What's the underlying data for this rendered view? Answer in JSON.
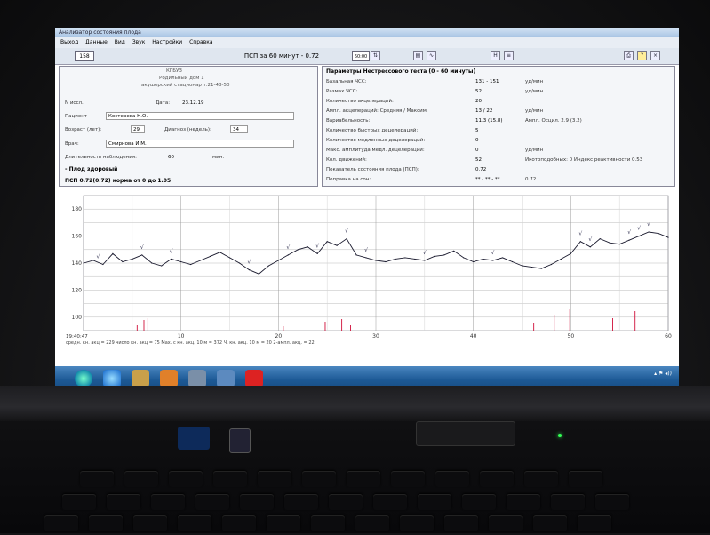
{
  "app": {
    "window_title": "Анализатор состояния плода",
    "menu": [
      "Выход",
      "Данные",
      "Вид",
      "Звук",
      "Настройки",
      "Справка"
    ]
  },
  "toolbar": {
    "id_value": "158",
    "title": "ПСП за 60 минут - 0.72",
    "zoom_value": "60:00",
    "buttons": [
      "chart-icon",
      "wave-icon",
      "H-icon",
      "list-icon",
      "print-icon",
      "help-icon",
      "close-icon"
    ]
  },
  "patient": {
    "org_name": "КГБУЗ",
    "org_line2": "Родильный дом 1",
    "org_line3": "акушерский стационар т.21-48-50",
    "study_label": "N иссл.",
    "date_label": "Дата:",
    "date_value": "23.12.19",
    "patient_label": "Пациент",
    "patient_value": "Костерева Н.О.",
    "age_label": "Возраст (лет):",
    "age_value": "29",
    "weeks_label": "Диагноз (недель):",
    "weeks_value": "34",
    "doctor_label": "Врач:",
    "doctor_value": "Смирнова И.М.",
    "duration_label": "Длительность наблюдения:",
    "duration_value": "60",
    "duration_unit": "мин.",
    "verdict": "- Плод здоровый",
    "psp_result": "ПСП 0.72(0.72) норма от 0 до 1.05"
  },
  "params": {
    "heading": "Параметры Нестрессового теста (0 - 60 минуты)",
    "rows": [
      {
        "label": "Базальная ЧСС:",
        "value": "131 - 151",
        "unit": "уд/мин"
      },
      {
        "label": "Размах ЧСС:",
        "value": "52",
        "unit": "уд/мин"
      },
      {
        "label": "Количество акцелераций:",
        "value": "20",
        "unit": ""
      },
      {
        "label": "Ампл. акцелераций: Средняя / Максим.",
        "value": "13 / 22",
        "unit": "уд/мин"
      },
      {
        "label": "Вариабельность:",
        "value": "11.3 (15.8)",
        "unit": "Ампл. Осцил.   2.9 (3.2)"
      },
      {
        "label": "Количество быстрых децелераций:",
        "value": "5",
        "unit": ""
      },
      {
        "label": "Количество медленных децелераций:",
        "value": "0",
        "unit": ""
      },
      {
        "label": "Макс. амплитуда медл. децелераций:",
        "value": "0",
        "unit": "уд/мин"
      },
      {
        "label": "Кол. движений:",
        "value": "52",
        "unit": "Икотоподобных: 0    Индекс реактивности   0.53"
      },
      {
        "label": "Показатель состояния плода (ПСП):",
        "value": "0.72",
        "unit": ""
      },
      {
        "label": "Поправка на сон:",
        "value": "** - ** - **",
        "unit": "0.72"
      }
    ]
  },
  "chart_data": {
    "type": "line",
    "title": "",
    "xlabel": "",
    "ylabel": "",
    "ylim": [
      90,
      190
    ],
    "y_ticks": [
      "180",
      "160",
      "140",
      "120",
      "100"
    ],
    "x_ticks": [
      "10",
      "20",
      "30",
      "40",
      "50",
      "60"
    ],
    "xlim": [
      0,
      60
    ],
    "grid": true,
    "start_time": "19:40:47",
    "footer": "средн. кн. акц = 229  число кн. акц = 75  Мах. с кн. акц. 10 м = 372  Ч. кн. акц. 10 м = 20  2-ампл. акц. = 22",
    "series": [
      {
        "name": "",
        "color": "#1a1a2e",
        "x": [
          0,
          1,
          2,
          3,
          4,
          5,
          6,
          7,
          8,
          9,
          10,
          11,
          12,
          13,
          14,
          15,
          16,
          17,
          18,
          19,
          20,
          21,
          22,
          23,
          24,
          25,
          26,
          27,
          28,
          29,
          30,
          31,
          32,
          33,
          34,
          35,
          36,
          37,
          38,
          39,
          40,
          41,
          42,
          43,
          44,
          45,
          46,
          47,
          48,
          49,
          50,
          51,
          52,
          53,
          54,
          55,
          56,
          57,
          58,
          59,
          60
        ],
        "y": [
          140,
          142,
          139,
          147,
          141,
          143,
          146,
          140,
          138,
          143,
          141,
          139,
          142,
          145,
          148,
          144,
          140,
          135,
          132,
          138,
          142,
          146,
          150,
          152,
          147,
          156,
          153,
          158,
          146,
          144,
          142,
          141,
          143,
          144,
          143,
          142,
          145,
          146,
          149,
          144,
          141,
          143,
          142,
          144,
          141,
          138,
          137,
          136,
          139,
          143,
          147,
          156,
          152,
          158,
          155,
          154,
          157,
          160,
          163,
          162,
          159
        ]
      }
    ],
    "movement_marks": {
      "color": "#d0103a",
      "x": [
        5.5,
        6.2,
        6.6,
        20.5,
        24.8,
        26.5,
        27.4,
        46.2,
        48.3,
        49.9,
        54.3,
        56.6
      ],
      "height": [
        6,
        12,
        14,
        5,
        10,
        13,
        6,
        9,
        18,
        24,
        14,
        22
      ]
    },
    "acceleration_marks": [
      1.5,
      6,
      9,
      17,
      21,
      24,
      27,
      29,
      35,
      42,
      51,
      52,
      56,
      57,
      58
    ]
  }
}
